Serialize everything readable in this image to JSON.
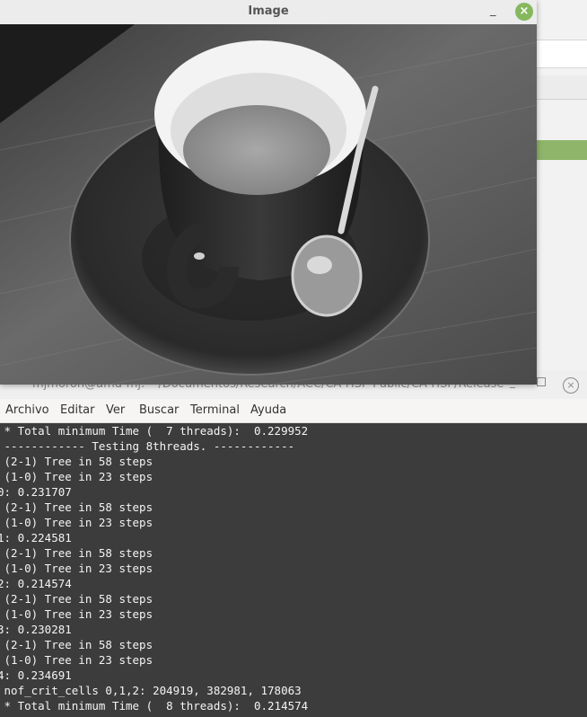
{
  "image_window": {
    "title": "Image",
    "minimize_glyph": "_",
    "close_glyph": "×"
  },
  "terminal": {
    "title": "mjmoron@amd-mj: ~/Documentos/Research/ACC/CA-HSP-Public/CA-HSP/Release",
    "minimize_glyph": "_",
    "close_glyph": "×",
    "menu": [
      "Archivo",
      "Editar",
      "Ver",
      "Buscar",
      "Terminal",
      "Ayuda"
    ],
    "lines": [
      " * Total minimum Time (  7 threads):  0.229952",
      " ------------ Testing 8threads. ------------",
      " (2-1) Tree in 58 steps",
      " (1-0) Tree in 23 steps",
      "0: 0.231707",
      " (2-1) Tree in 58 steps",
      " (1-0) Tree in 23 steps",
      "1: 0.224581",
      " (2-1) Tree in 58 steps",
      " (1-0) Tree in 23 steps",
      "2: 0.214574",
      " (2-1) Tree in 58 steps",
      " (1-0) Tree in 23 steps",
      "3: 0.230281",
      " (2-1) Tree in 58 steps",
      " (1-0) Tree in 23 steps",
      "4: 0.234691",
      " nof_crit_cells 0,1,2: 204919, 382981, 178063",
      " * Total minimum Time (  8 threads):  0.214574"
    ]
  }
}
